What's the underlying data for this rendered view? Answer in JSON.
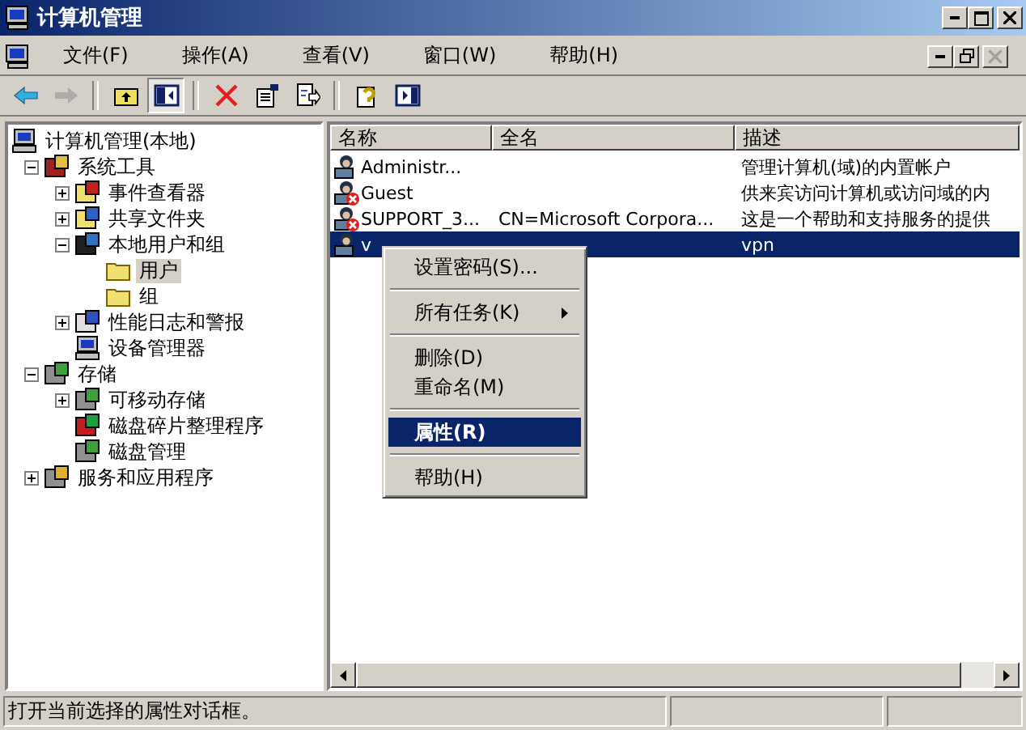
{
  "window": {
    "title": "计算机管理"
  },
  "menu_bar": [
    "文件(F)",
    "操作(A)",
    "查看(V)",
    "窗口(W)",
    "帮助(H)"
  ],
  "toolbar": [
    {
      "kind": "back",
      "disabled": false,
      "pressed": false
    },
    {
      "kind": "forward",
      "disabled": true,
      "pressed": false
    },
    {
      "kind": "separator"
    },
    {
      "kind": "up",
      "disabled": false,
      "pressed": false
    },
    {
      "kind": "tree",
      "disabled": false,
      "pressed": true
    },
    {
      "kind": "separator"
    },
    {
      "kind": "delete",
      "disabled": false,
      "pressed": false
    },
    {
      "kind": "properties",
      "disabled": false,
      "pressed": false
    },
    {
      "kind": "export",
      "disabled": false,
      "pressed": false
    },
    {
      "kind": "separator"
    },
    {
      "kind": "help",
      "disabled": false,
      "pressed": false
    },
    {
      "kind": "panel",
      "disabled": false,
      "pressed": false
    }
  ],
  "tree": [
    {
      "label": "计算机管理(本地)",
      "children": [
        {
          "label": "系统工具",
          "expanded": true,
          "selected": false,
          "children": [
            {
              "label": "事件查看器",
              "expanded": false,
              "selected": false
            },
            {
              "label": "共享文件夹",
              "expanded": false,
              "selected": false
            },
            {
              "label": "本地用户和组",
              "expanded": true,
              "selected": false,
              "children": [
                {
                  "label": "用户",
                  "selected": true
                },
                {
                  "label": "组",
                  "selected": false
                }
              ]
            },
            {
              "label": "性能日志和警报",
              "expanded": false,
              "selected": false
            },
            {
              "label": "设备管理器",
              "selected": false
            }
          ]
        },
        {
          "label": "存储",
          "expanded": true,
          "selected": false,
          "children": [
            {
              "label": "可移动存储",
              "expanded": false,
              "selected": false
            },
            {
              "label": "磁盘碎片整理程序",
              "selected": false
            },
            {
              "label": "磁盘管理",
              "selected": false
            }
          ]
        },
        {
          "label": "服务和应用程序",
          "expanded": false,
          "selected": false
        }
      ]
    }
  ],
  "table": {
    "columns": [
      "名称",
      "全名",
      "描述"
    ],
    "rows": [
      {
        "name": "Administr...",
        "full_name": "",
        "description": "管理计算机(域)的内置帐户",
        "disabled": false,
        "selected": false
      },
      {
        "name": "Guest",
        "full_name": "",
        "description": "供来宾访问计算机或访问域的内",
        "disabled": true,
        "selected": false
      },
      {
        "name": "SUPPORT_3...",
        "full_name": "CN=Microsoft Corpora...",
        "description": "这是一个帮助和支持服务的提供",
        "disabled": true,
        "selected": false
      },
      {
        "name": "v",
        "full_name": "",
        "description": "vpn",
        "disabled": false,
        "selected": true
      }
    ]
  },
  "context_menu": [
    {
      "kind": "item",
      "label": "设置密码(S)...",
      "selected": false
    },
    {
      "kind": "separator"
    },
    {
      "kind": "item",
      "label": "所有任务(K)",
      "submenu": true,
      "selected": false
    },
    {
      "kind": "separator"
    },
    {
      "kind": "item",
      "label": "删除(D)",
      "selected": false
    },
    {
      "kind": "item",
      "label": "重命名(M)",
      "selected": false
    },
    {
      "kind": "separator"
    },
    {
      "kind": "item",
      "label": "属性(R)",
      "default": true,
      "selected": true
    },
    {
      "kind": "separator"
    },
    {
      "kind": "item",
      "label": "帮助(H)",
      "selected": false
    }
  ],
  "status_bar": {
    "text": "打开当前选择的属性对话框。"
  }
}
